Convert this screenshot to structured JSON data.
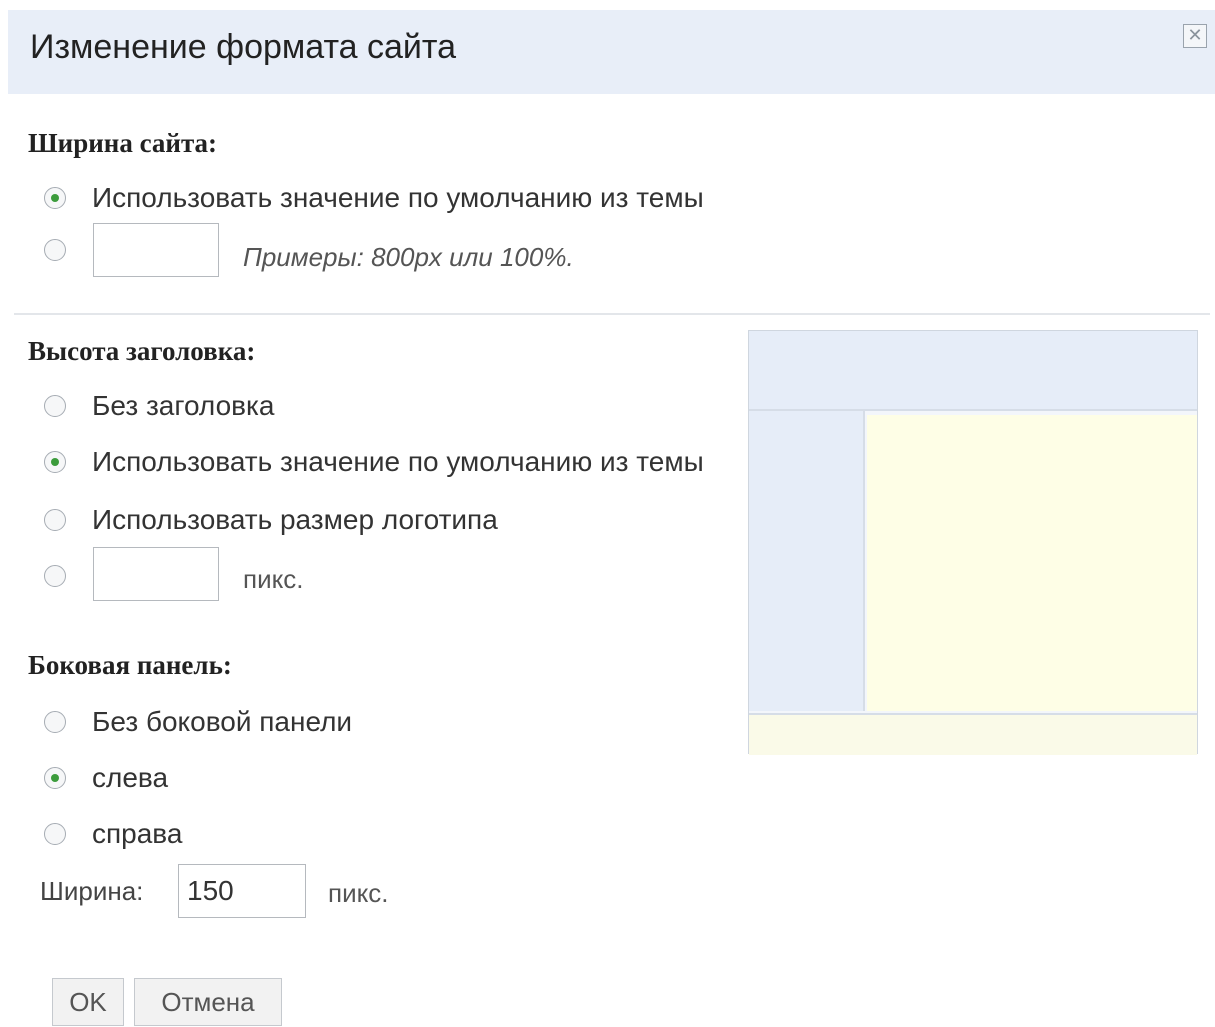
{
  "dialog": {
    "title": "Изменение формата сайта",
    "close_icon": "close-icon"
  },
  "site_width": {
    "heading": "Ширина сайта:",
    "options": [
      {
        "label": "Использовать значение по умолчанию из темы",
        "checked": true
      },
      {
        "label": "",
        "checked": false,
        "input_value": "",
        "hint": "Примеры: 800px или 100%."
      }
    ]
  },
  "header_height": {
    "heading": "Высота заголовка:",
    "options": [
      {
        "label": "Без заголовка",
        "checked": false
      },
      {
        "label": "Использовать значение по умолчанию из темы",
        "checked": true
      },
      {
        "label": "Использовать размер логотипа",
        "checked": false
      },
      {
        "label": "",
        "checked": false,
        "input_value": "",
        "unit": "пикс."
      }
    ]
  },
  "sidebar": {
    "heading": "Боковая панель:",
    "options": [
      {
        "label": "Без боковой панели",
        "checked": false
      },
      {
        "label": "слева",
        "checked": true
      },
      {
        "label": "справа",
        "checked": false
      }
    ],
    "width_label": "Ширина:",
    "width_value": "150",
    "width_unit": "пикс."
  },
  "buttons": {
    "ok": "OK",
    "cancel": "Отмена"
  },
  "colors": {
    "titlebar": "#e8eef8",
    "preview_header": "#e6edf8",
    "preview_main": "#fefee6",
    "radio_checked": "#3c9c3c"
  }
}
